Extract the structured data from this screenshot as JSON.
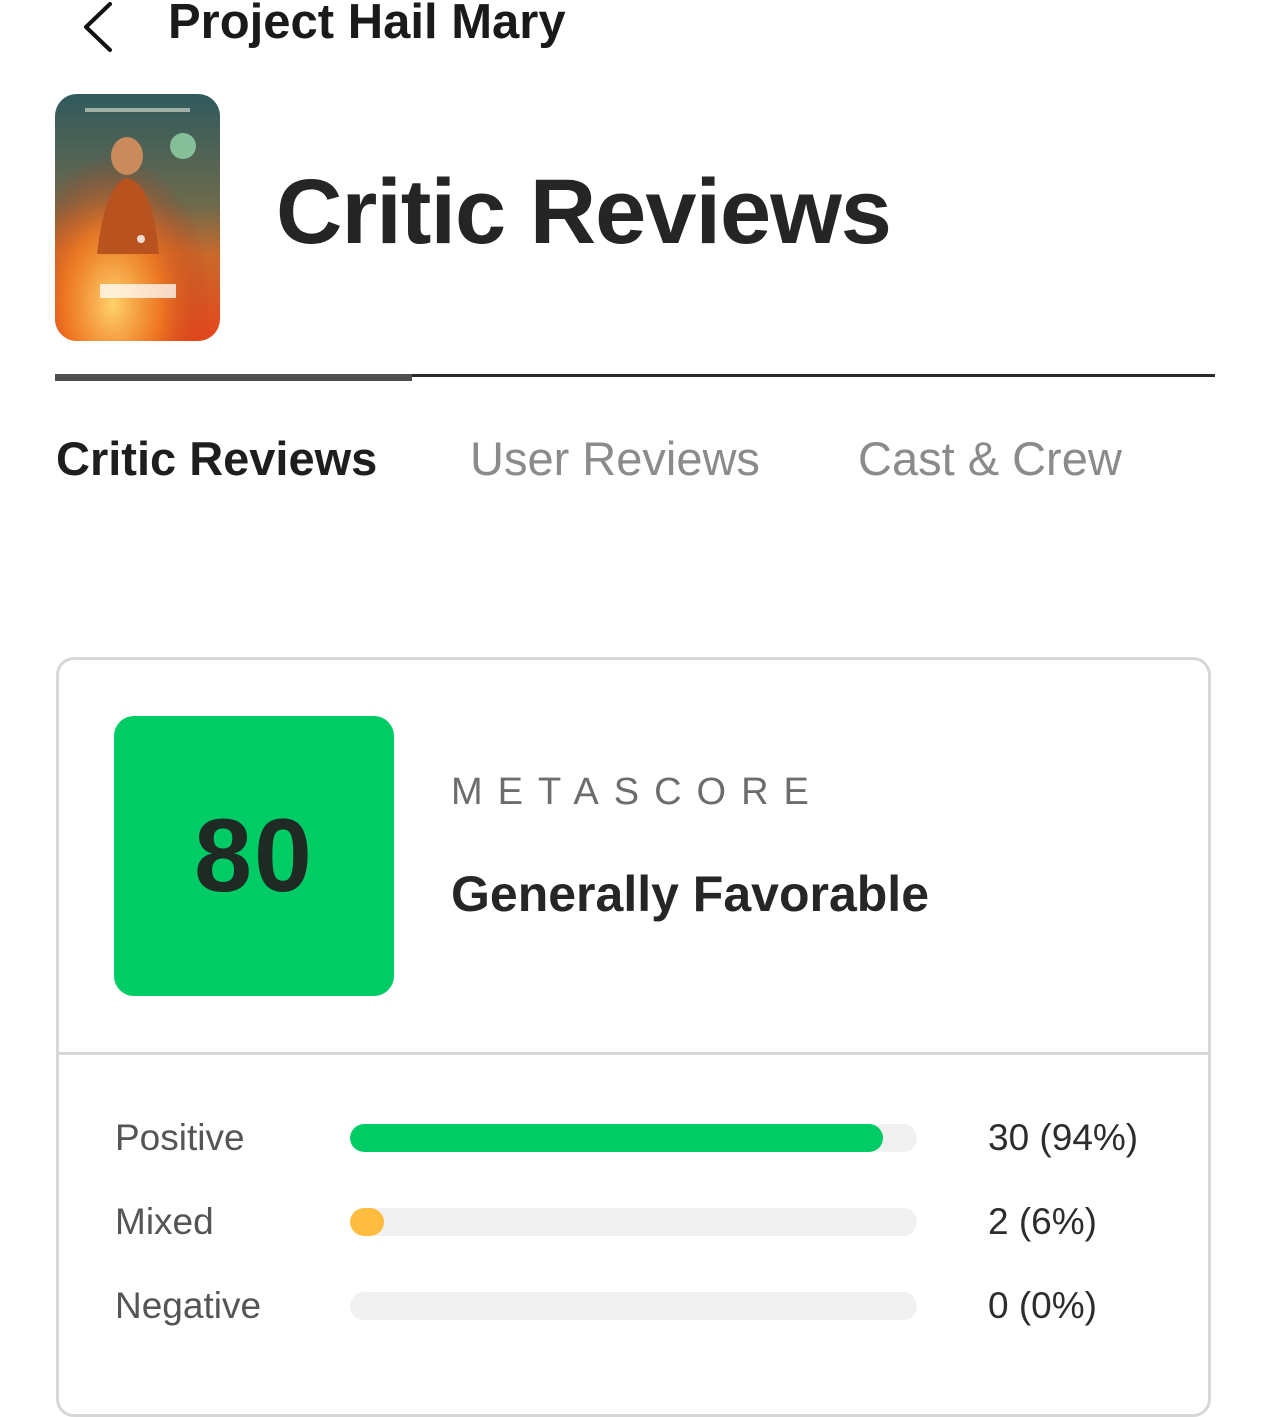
{
  "header": {
    "back_icon": "chevron-left-icon",
    "title": "Project Hail Mary"
  },
  "page": {
    "title": "Critic Reviews"
  },
  "tabs": [
    {
      "label": "Critic Reviews",
      "active": true
    },
    {
      "label": "User Reviews",
      "active": false
    },
    {
      "label": "Cast & Crew",
      "active": false
    }
  ],
  "metascore": {
    "score": "80",
    "label": "METASCORE",
    "verdict": "Generally Favorable",
    "color": "#00cc66"
  },
  "distribution": [
    {
      "label": "Positive",
      "count_text": "30 (94%)",
      "percent": 94,
      "color": "#00cc66"
    },
    {
      "label": "Mixed",
      "count_text": "2 (6%)",
      "percent": 6,
      "color": "#ffbd3f"
    },
    {
      "label": "Negative",
      "count_text": "0 (0%)",
      "percent": 0,
      "color": "#ff6874"
    }
  ]
}
